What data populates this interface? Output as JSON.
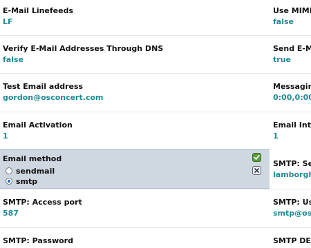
{
  "left_column": [
    {
      "label": "E-Mail Linefeeds",
      "value": "LF"
    },
    {
      "label": "Verify E-Mail Addresses Through DNS",
      "value": "false"
    },
    {
      "label": "Test Email address",
      "value": "gordon@osconcert.com"
    },
    {
      "label": "Email Activation",
      "value": "1"
    },
    {
      "label": "SMTP: Access port",
      "value": "587"
    },
    {
      "label": "SMTP: Password",
      "value": ""
    }
  ],
  "edit_panel": {
    "label": "Email method",
    "options": [
      {
        "label": "sendmail",
        "selected": false
      },
      {
        "label": "smtp",
        "selected": true
      }
    ],
    "save_icon": "checkmark-icon",
    "cancel_icon": "close-icon"
  },
  "right_column": [
    {
      "label": "Use MIME",
      "value": "false"
    },
    {
      "label": "Send E-M",
      "value": "true"
    },
    {
      "label": "Messagin",
      "value": "0:00,0:00"
    },
    {
      "label": "Email Int",
      "value": "1"
    },
    {
      "label": "SMTP: Se",
      "value": "lamborgh"
    },
    {
      "label": "SMTP: Us",
      "value": "smtp@os"
    },
    {
      "label": "SMTP DE",
      "value": ""
    }
  ],
  "colors": {
    "value_text": "#1f8a98",
    "panel_bg": "#cfd7e0",
    "save_button": "#5a9a3a"
  }
}
